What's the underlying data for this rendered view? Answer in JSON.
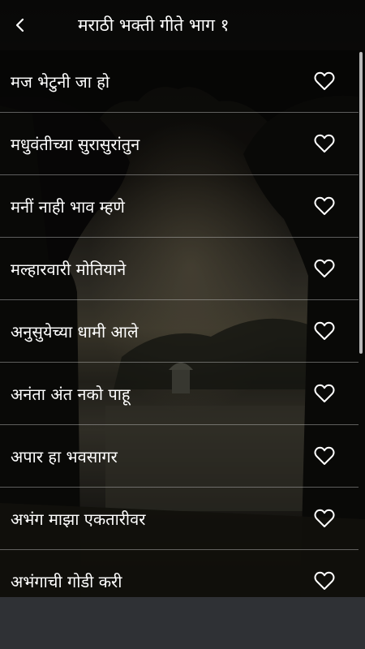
{
  "header": {
    "back_icon": "chevron-left-icon",
    "title": "मराठी भक्ती गीते भाग १"
  },
  "songs": [
    {
      "label": "मज भेटुनी जा हो",
      "icon": "heart-outline-icon"
    },
    {
      "label": "मधुवंतीच्या सुरासुरांतुन",
      "icon": "heart-outline-icon"
    },
    {
      "label": "मनीं नाही भाव म्हणे",
      "icon": "heart-outline-icon"
    },
    {
      "label": "मल्हारवारी मोतियाने",
      "icon": "heart-outline-icon"
    },
    {
      "label": "अनुसुयेच्या धामी आले",
      "icon": "heart-outline-icon"
    },
    {
      "label": "अनंता अंत नको पाहू",
      "icon": "heart-outline-icon"
    },
    {
      "label": "अपार हा भवसागर",
      "icon": "heart-outline-icon"
    },
    {
      "label": "अभंग माझा एकतारीवर",
      "icon": "heart-outline-icon"
    },
    {
      "label": "अभंगाची गोडी करी",
      "icon": "heart-outline-icon"
    }
  ],
  "colors": {
    "text": "#ffffff",
    "divider": "#c8c8c8",
    "bottom_bar": "#2f3135"
  }
}
